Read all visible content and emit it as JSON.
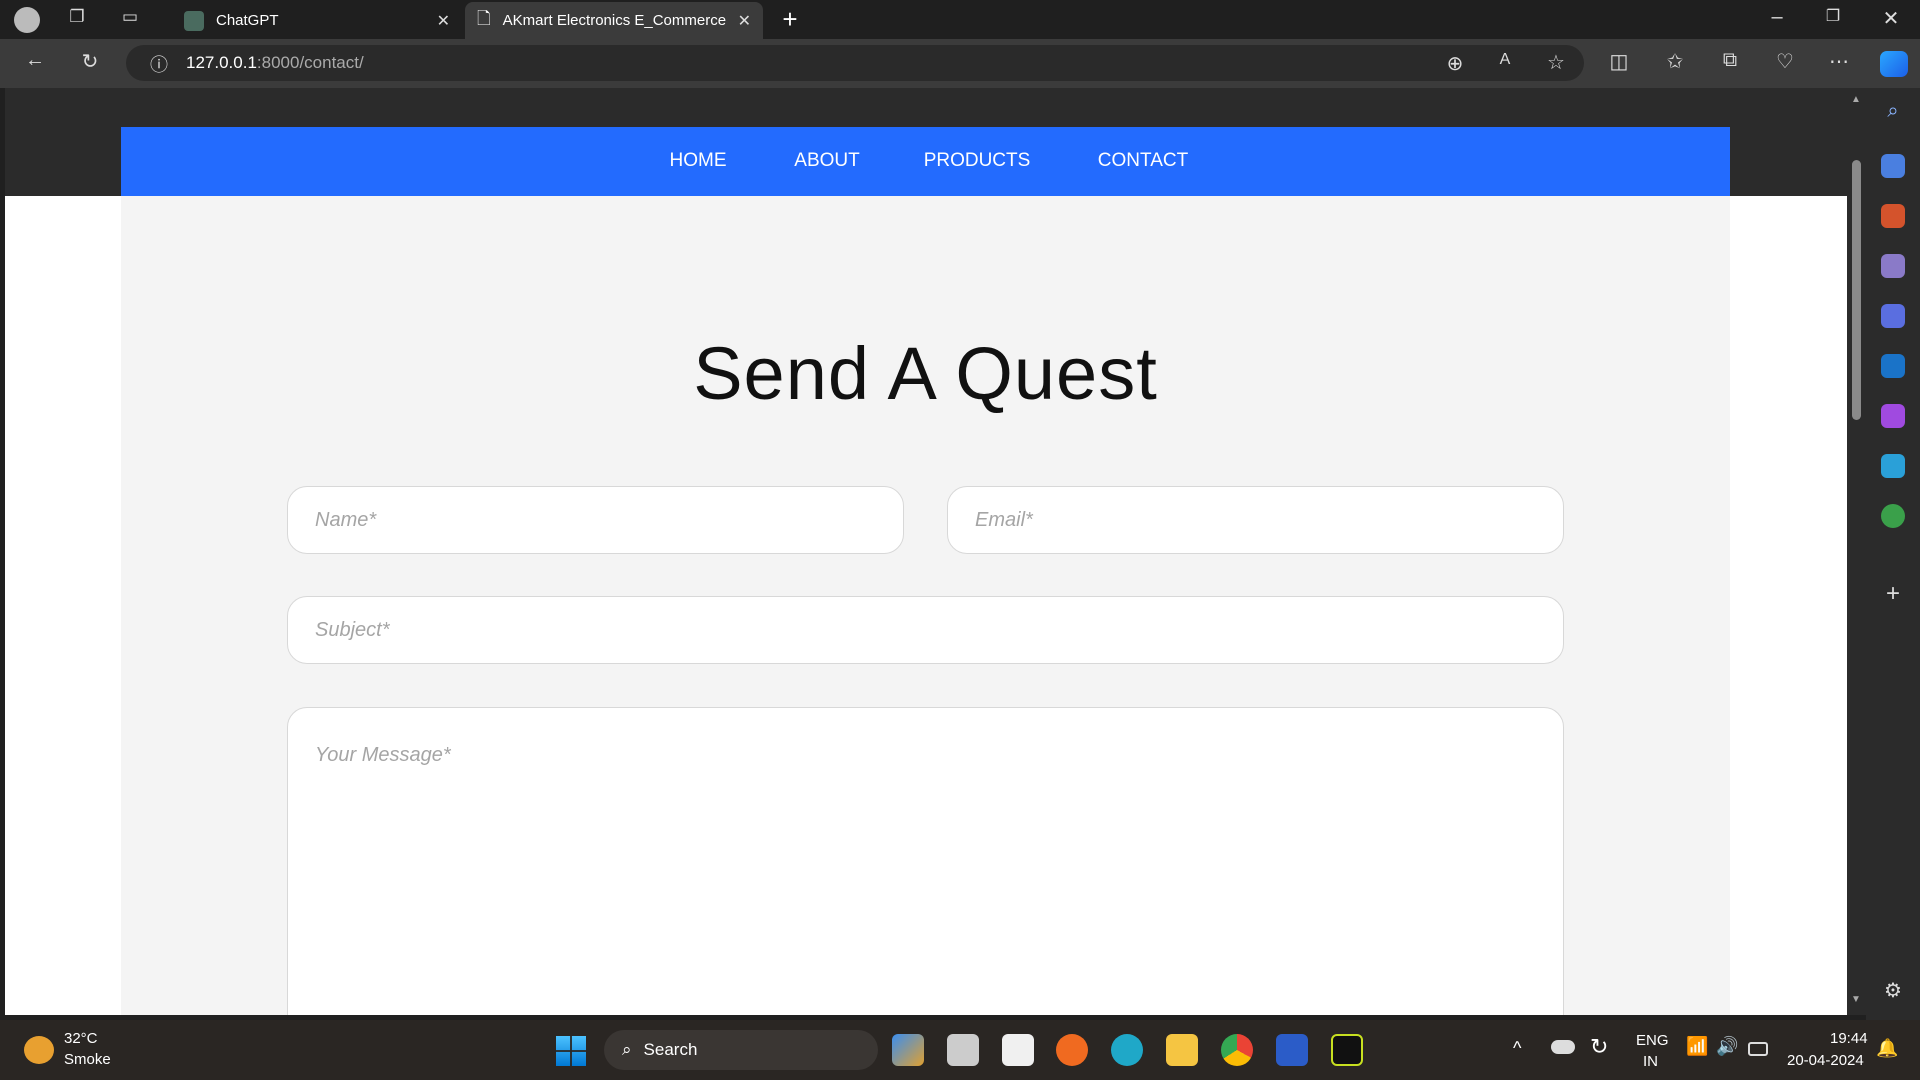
{
  "browser": {
    "tabs": [
      {
        "title": "ChatGPT",
        "active": false
      },
      {
        "title": "AKmart Electronics E_Commerce",
        "active": true
      }
    ],
    "url_host": "127.0.0.1",
    "url_rest": ":8000/contact/"
  },
  "nav": {
    "items": [
      "HOME",
      "ABOUT",
      "PRODUCTS",
      "CONTACT"
    ],
    "color": "#236bfe"
  },
  "page": {
    "title": "Send A Quest",
    "name_placeholder": "Name*",
    "email_placeholder": "Email*",
    "subject_placeholder": "Subject*",
    "message_placeholder": "Your Message*"
  },
  "taskbar": {
    "weather_temp": "32°C",
    "weather_desc": "Smoke",
    "search_label": "Search",
    "lang1": "ENG",
    "lang2": "IN",
    "time": "19:44",
    "date": "20-04-2024"
  }
}
